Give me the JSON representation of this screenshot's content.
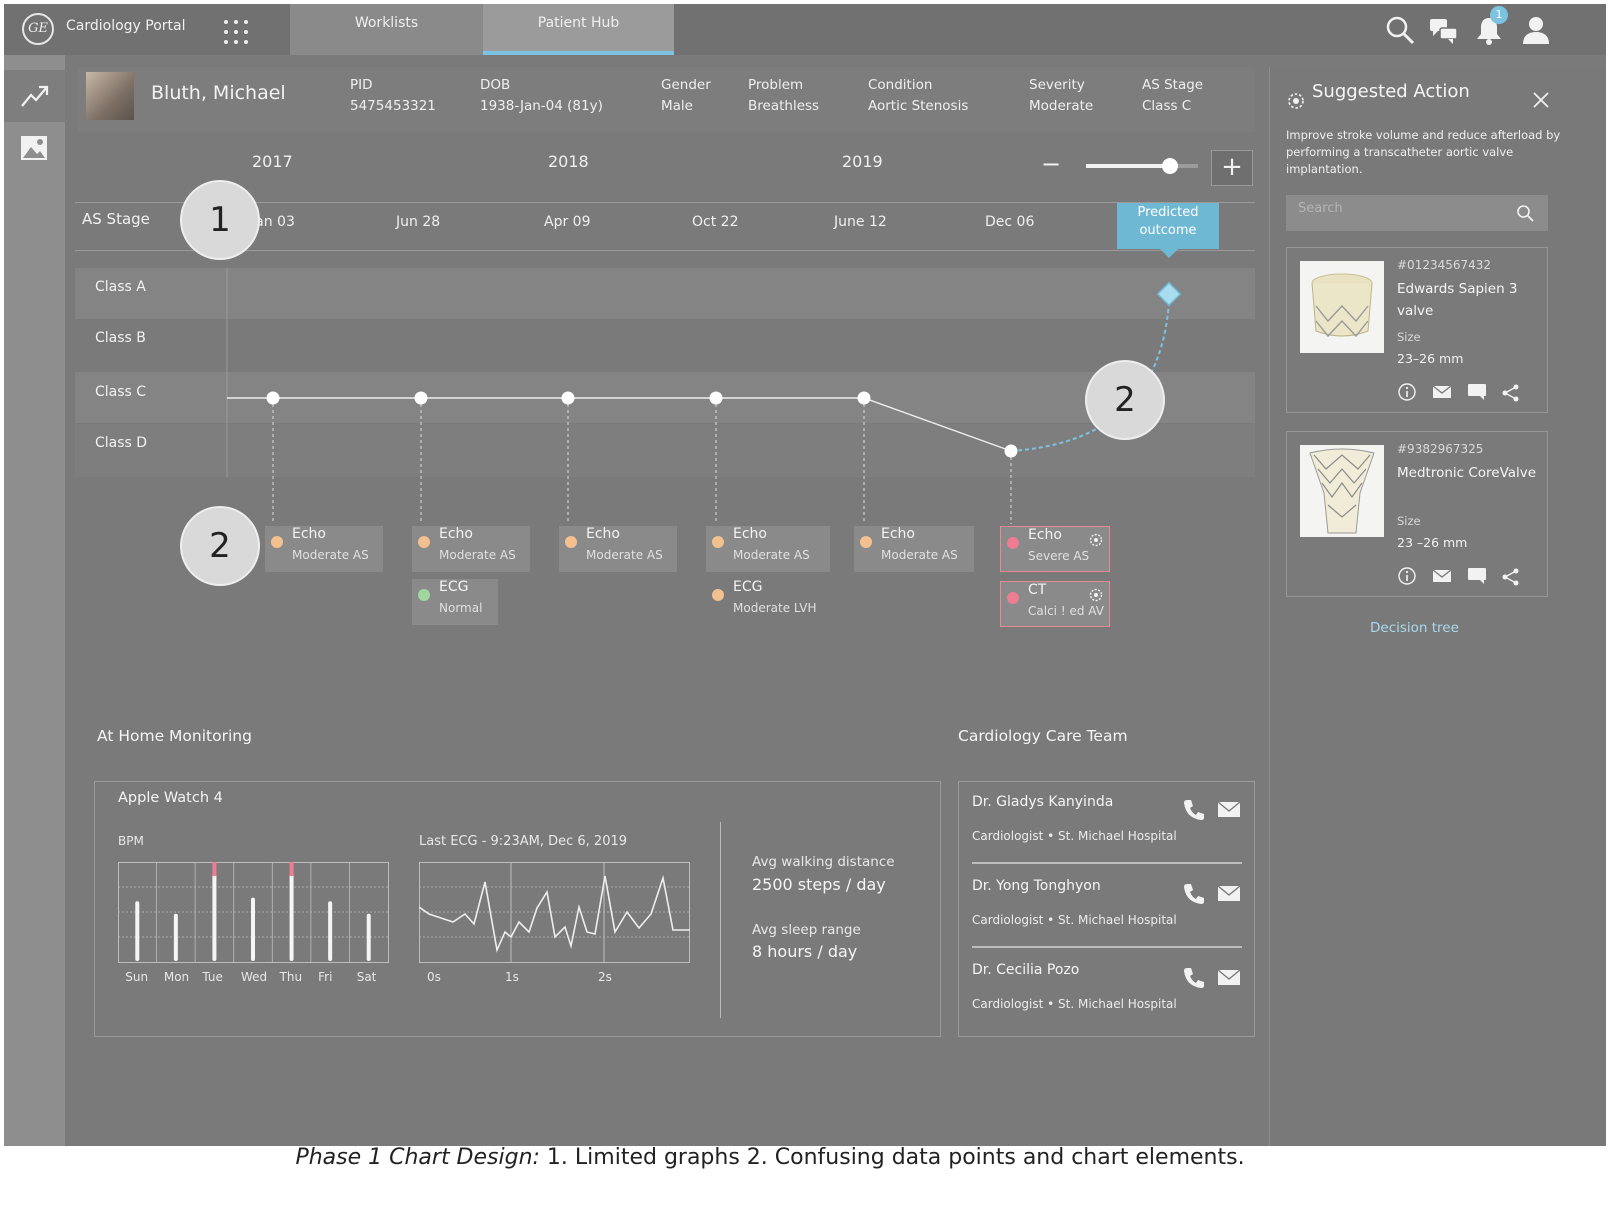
{
  "app": {
    "title": "Cardiology Portal",
    "logo_text": "GE"
  },
  "nav_tabs": [
    {
      "label": "Worklists"
    },
    {
      "label": "Patient Hub"
    }
  ],
  "notifications": {
    "count": "1"
  },
  "patient": {
    "name": "Bluth, Michael",
    "fields": [
      {
        "label": "PID",
        "value": "5475453321"
      },
      {
        "label": "DOB",
        "value": "1938-Jan-04 (81y)"
      },
      {
        "label": "Gender",
        "value": "Male"
      },
      {
        "label": "Problem",
        "value": "Breathless"
      },
      {
        "label": "Condition",
        "value": "Aortic Stenosis"
      },
      {
        "label": "Severity",
        "value": "Moderate"
      },
      {
        "label": "AS Stage",
        "value": "Class C"
      }
    ]
  },
  "timeline": {
    "years": [
      "2017",
      "2018",
      "2019"
    ],
    "axis_label": "AS Stage",
    "dates": [
      "Jan 03",
      "Jun 28",
      "Apr 09",
      "Oct 22",
      "June 12",
      "Dec 06"
    ],
    "predicted_label": "Predicted outcome",
    "classes": [
      "Class A",
      "Class B",
      "Class C",
      "Class D"
    ],
    "zoom_minus": "−",
    "zoom_plus": "+",
    "zoom_level": 0.75
  },
  "chart_data": {
    "type": "line",
    "title": "",
    "xlabel": "",
    "ylabel": "AS Stage",
    "categories": [
      "Jan 03",
      "Jun 28",
      "Apr 09",
      "Oct 22",
      "June 12",
      "Dec 06",
      "Predicted outcome"
    ],
    "series": [
      {
        "values": [
          "Class C",
          "Class C",
          "Class C",
          "Class C",
          "Class C",
          "Class D",
          null
        ]
      },
      {
        "values": [
          null,
          null,
          null,
          null,
          null,
          "Class D",
          "Class A"
        ]
      }
    ],
    "y_categories": [
      "Class A",
      "Class B",
      "Class C",
      "Class D"
    ]
  },
  "events": [
    {
      "title": "Echo",
      "sub": "Moderate AS",
      "status": "moderate",
      "color": "#f3c08f"
    },
    {
      "title": "Echo",
      "sub": "Moderate AS",
      "status": "moderate",
      "color": "#f3c08f"
    },
    {
      "title": "ECG",
      "sub": "Normal",
      "status": "normal",
      "color": "#9fd79f"
    },
    {
      "title": "Echo",
      "sub": "Moderate AS",
      "status": "moderate",
      "color": "#f3c08f"
    },
    {
      "title": "Echo",
      "sub": "Moderate AS",
      "status": "moderate",
      "color": "#f3c08f"
    },
    {
      "title": "ECG",
      "sub": "Moderate LVH",
      "status": "moderate",
      "color": "#f3c08f"
    },
    {
      "title": "Echo",
      "sub": "Moderate AS",
      "status": "moderate",
      "color": "#f3c08f"
    },
    {
      "title": "Echo",
      "sub": "Severe AS",
      "status": "severe",
      "color": "#ee7d93"
    },
    {
      "title": "CT",
      "sub": "Calci ! ed AV",
      "status": "severe",
      "color": "#ee7d93"
    }
  ],
  "callouts": [
    "1",
    "2",
    "2"
  ],
  "home_monitoring": {
    "title": "At Home Monitoring",
    "device": "Apple Watch 4",
    "bpm_label": "BPM",
    "days": [
      "Sun",
      "Mon",
      "Tue",
      "Wed",
      "Thu",
      "Fri",
      "Sat"
    ],
    "bpm_levels": [
      0.62,
      0.48,
      0.92,
      0.66,
      0.92,
      0.62,
      0.48
    ],
    "bpm_alert_days": [
      "Tue",
      "Thu"
    ],
    "ecg_label": "Last ECG - 9:23AM, Dec 6, 2019",
    "ecg_ticks": [
      "0s",
      "1s",
      "2s"
    ],
    "walk_label": "Avg walking distance",
    "walk_value": "2500 steps / day",
    "sleep_label": "Avg sleep range",
    "sleep_value": "8 hours / day"
  },
  "care_team": {
    "title": "Cardiology Care Team",
    "members": [
      {
        "name": "Dr. Gladys Kanyinda",
        "role": "Cardiologist • St. Michael Hospital"
      },
      {
        "name": "Dr. Yong Tonghyon",
        "role": "Cardiologist • St. Michael Hospital"
      },
      {
        "name": "Dr. Cecilia Pozo",
        "role": "Cardiologist • St. Michael Hospital"
      }
    ]
  },
  "suggested_action": {
    "title": "Suggested Action",
    "description": "Improve stroke volume and reduce afterload by performing a transcatheter aortic valve implantation.",
    "search_placeholder": "Search",
    "products": [
      {
        "id": "#01234567432",
        "name": "Edwards Sapien 3 valve",
        "size_label": "Size",
        "size": "23–26 mm"
      },
      {
        "id": "#9382967325",
        "name": "Medtronic CoreValve",
        "size_label": "Size",
        "size": "23 –26 mm"
      }
    ],
    "link": "Decision tree"
  },
  "caption": {
    "prefix": "Phase 1 Chart Design:",
    "text": " 1. Limited graphs 2. Confusing data points and chart elements."
  },
  "colors": {
    "accent": "#7bc3e0",
    "predicted_box": "#6fb8d4",
    "severe": "#ee7d93",
    "moderate": "#f3c08f",
    "normal": "#9fd79f"
  }
}
